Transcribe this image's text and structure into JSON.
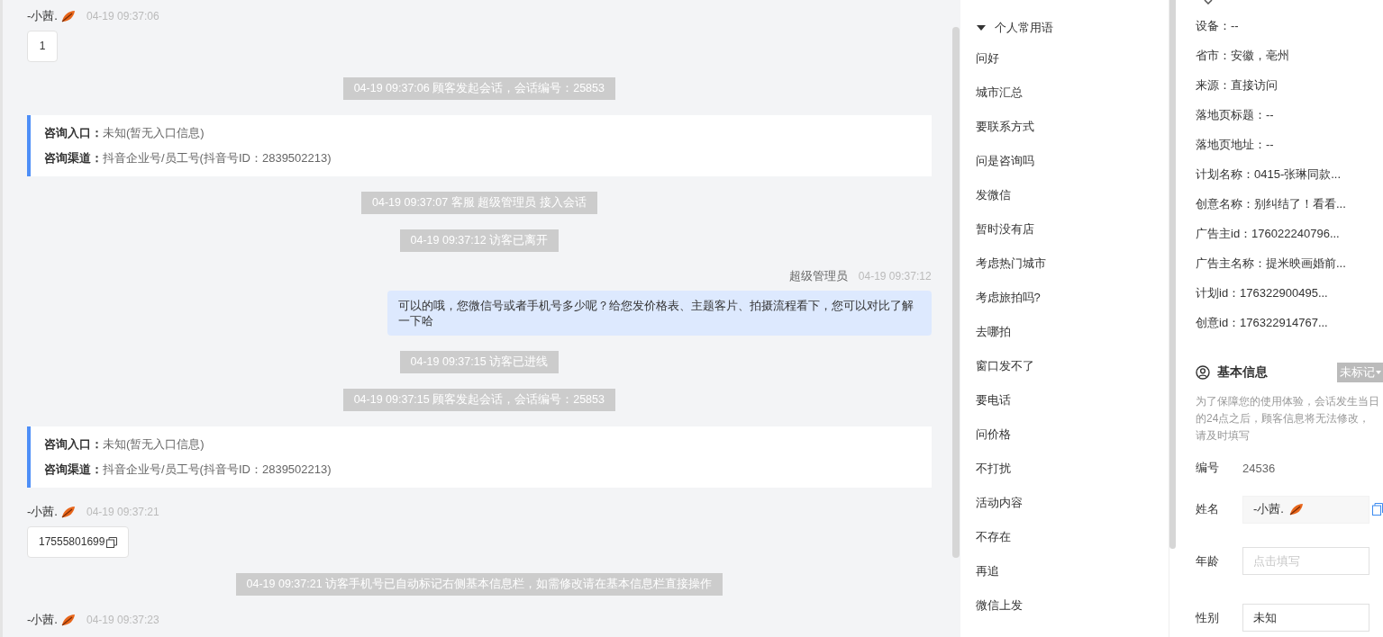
{
  "chat": {
    "messages": [
      {
        "kind": "visitor",
        "name": "-小茜.",
        "time": "04-19 09:37:06",
        "text": "1",
        "copyable": false
      },
      {
        "kind": "notice",
        "text": "04-19 09:37:06 顾客发起会话，会话编号：25853"
      },
      {
        "kind": "info",
        "rows": [
          {
            "label": "咨询入口：",
            "value": "未知(暂无入口信息)"
          },
          {
            "label": "咨询渠道：",
            "value": "抖音企业号/员工号(抖音号ID：2839502213)"
          }
        ]
      },
      {
        "kind": "notice",
        "text": "04-19 09:37:07 客服 超级管理员 接入会话"
      },
      {
        "kind": "notice",
        "text": "04-19 09:37:12 访客已离开"
      },
      {
        "kind": "agent",
        "name": "超级管理员",
        "time": "04-19 09:37:12",
        "text": "可以的哦，您微信号或者手机号多少呢？给您发价格表、主题客片、拍摄流程看下，您可以对比了解一下哈"
      },
      {
        "kind": "notice",
        "text": "04-19 09:37:15 访客已进线"
      },
      {
        "kind": "notice",
        "text": "04-19 09:37:15 顾客发起会话，会话编号：25853"
      },
      {
        "kind": "info",
        "rows": [
          {
            "label": "咨询入口：",
            "value": "未知(暂无入口信息)"
          },
          {
            "label": "咨询渠道：",
            "value": "抖音企业号/员工号(抖音号ID：2839502213)"
          }
        ]
      },
      {
        "kind": "visitor",
        "name": "-小茜.",
        "time": "04-19 09:37:21",
        "text": "17555801699",
        "copyable": true
      },
      {
        "kind": "notice",
        "text": "04-19 09:37:21 访客手机号已自动标记右侧基本信息栏，如需修改请在基本信息栏直接操作"
      },
      {
        "kind": "visitor",
        "name": "-小茜.",
        "time": "04-19 09:37:23"
      }
    ]
  },
  "phrases": {
    "group": {
      "label": "个人常用语",
      "expanded": true
    },
    "items": [
      "问好",
      "城市汇总",
      "要联系方式",
      "问是咨询吗",
      "发微信",
      "暂时没有店",
      "考虑热门城市",
      "考虑旅拍吗?",
      "去哪拍",
      "窗口发不了",
      "要电话",
      "问价格",
      "不打扰",
      "活动内容",
      "不存在",
      "再追",
      "微信上发"
    ]
  },
  "visitor_info": {
    "rows": [
      "设备：--",
      "省市：安徽，亳州",
      "来源：直接访问",
      "落地页标题：--",
      "落地页地址：--",
      "计划名称：0415-张琳同款...",
      "创意名称：别纠结了！看看...",
      "广告主id：176022240796...",
      "广告主名称：提米映画婚前...",
      "计划id：176322900495...",
      "创意id：176322914767..."
    ]
  },
  "basic_info": {
    "title": "基本信息",
    "tag": "未标记",
    "note": "为了保障您的使用体验，会话发生当日的24点之后，顾客信息将无法修改，请及时填写",
    "fields": [
      {
        "kind": "text",
        "label": "编号",
        "value": "24536"
      },
      {
        "kind": "input",
        "label": "姓名",
        "value": "-小茜.",
        "readonly": true,
        "copyable": true
      },
      {
        "kind": "input",
        "label": "年龄",
        "placeholder": "点击填写",
        "readonly": false,
        "copyable": false
      },
      {
        "kind": "input",
        "label": "性别",
        "value": "未知",
        "readonly": false,
        "copyable": false
      }
    ]
  }
}
